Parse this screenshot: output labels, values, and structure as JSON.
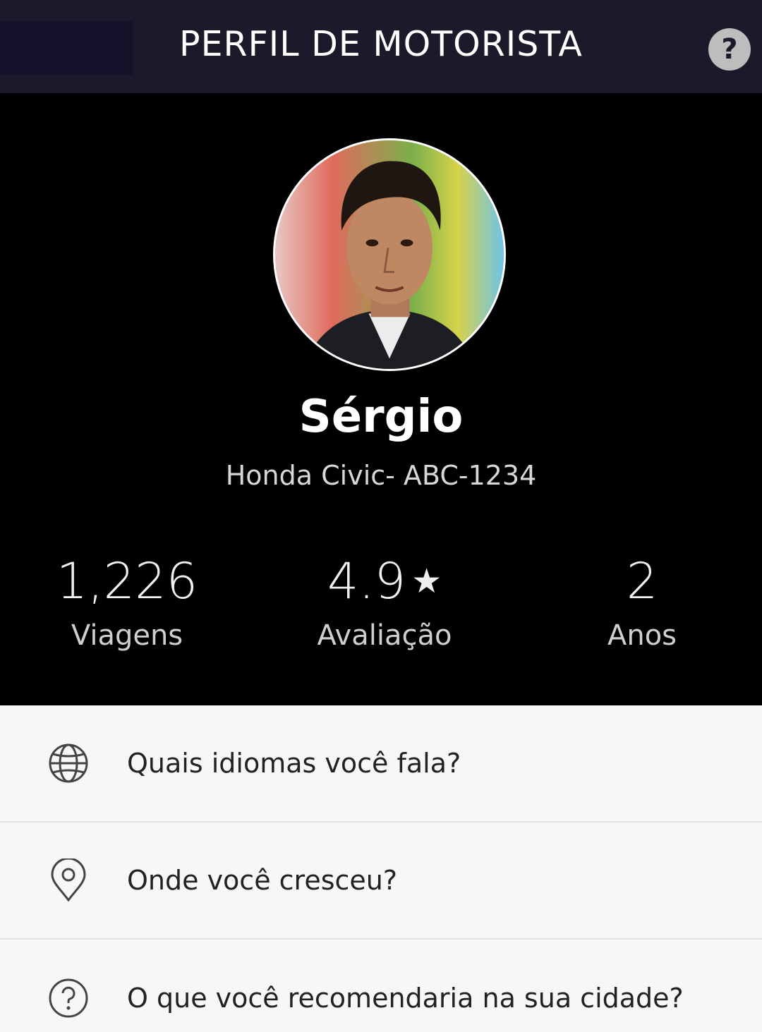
{
  "header": {
    "title": "PERFIL DE MOTORISTA",
    "help_icon": "help-circle-icon",
    "help_glyph": "?"
  },
  "driver": {
    "name": "Sérgio",
    "car": "Honda Civic- ABC-1234",
    "avatar_icon": "driver-photo"
  },
  "stats": {
    "trips": {
      "value": "1,226",
      "label": "Viagens"
    },
    "rating": {
      "value": "4.9",
      "star": "★",
      "label": "Avaliação"
    },
    "years": {
      "value": "2",
      "label": "Anos"
    }
  },
  "questions": [
    {
      "icon": "globe-icon",
      "text": "Quais idiomas você fala?"
    },
    {
      "icon": "location-pin-icon",
      "text": "Onde você cresceu?"
    },
    {
      "icon": "question-circle-icon",
      "text": "O que você recomendaria na sua cidade?"
    }
  ],
  "colors": {
    "header_bg": "#1b1a2b",
    "profile_bg": "#000000",
    "list_bg": "#f7f7f7"
  }
}
